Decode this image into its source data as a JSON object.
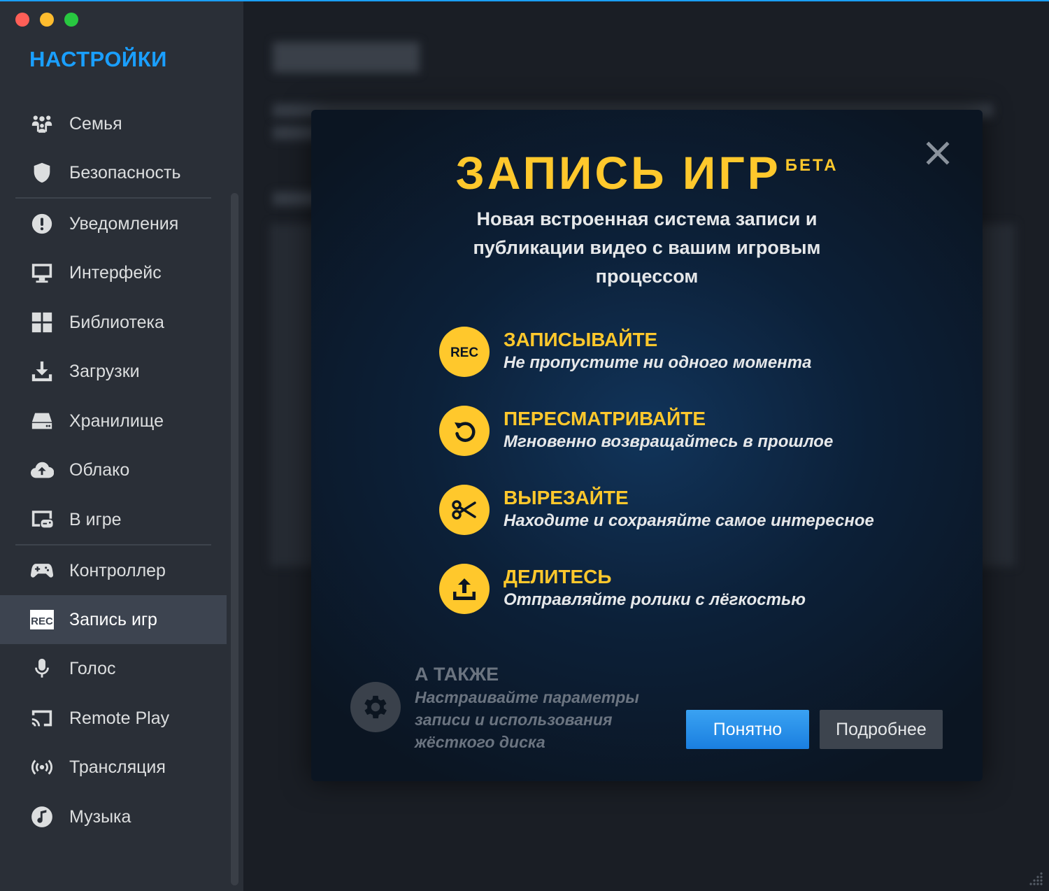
{
  "sidebar": {
    "title": "НАСТРОЙКИ",
    "items": [
      {
        "label": "Семья",
        "icon": "family-icon"
      },
      {
        "label": "Безопасность",
        "icon": "shield-icon"
      },
      {
        "label": "Уведомления",
        "icon": "notification-icon"
      },
      {
        "label": "Интерфейс",
        "icon": "monitor-icon"
      },
      {
        "label": "Библиотека",
        "icon": "grid-icon"
      },
      {
        "label": "Загрузки",
        "icon": "download-icon"
      },
      {
        "label": "Хранилище",
        "icon": "drive-icon"
      },
      {
        "label": "Облако",
        "icon": "cloud-icon"
      },
      {
        "label": "В игре",
        "icon": "ingame-icon"
      },
      {
        "label": "Контроллер",
        "icon": "gamepad-icon"
      },
      {
        "label": "Запись игр",
        "icon": "rec-icon",
        "active": true
      },
      {
        "label": "Голос",
        "icon": "microphone-icon"
      },
      {
        "label": "Remote Play",
        "icon": "cast-icon"
      },
      {
        "label": "Трансляция",
        "icon": "broadcast-icon"
      },
      {
        "label": "Музыка",
        "icon": "music-icon"
      }
    ]
  },
  "modal": {
    "title": "ЗАПИСЬ ИГР",
    "badge": "БЕТА",
    "subtitle": "Новая встроенная система записи и публикации видео с вашим игровым процессом",
    "features": [
      {
        "heading": "ЗАПИСЫВАЙТЕ",
        "description": "Не пропустите ни одного момента",
        "icon": "rec-icon"
      },
      {
        "heading": "ПЕРЕСМАТРИВАЙТЕ",
        "description": "Мгновенно возвращайтесь в прошлое",
        "icon": "replay-icon"
      },
      {
        "heading": "ВЫРЕЗАЙТЕ",
        "description": "Находите и сохраняйте самое интересное",
        "icon": "scissors-icon"
      },
      {
        "heading": "ДЕЛИТЕСЬ",
        "description": "Отправляйте ролики с лёгкостью",
        "icon": "upload-icon"
      }
    ],
    "also": {
      "heading": "А ТАКЖЕ",
      "description": "Настраивайте параметры записи и использования жёсткого диска",
      "icon": "gear-icon"
    },
    "buttons": {
      "ok": "Понятно",
      "more": "Подробнее"
    }
  },
  "colors": {
    "accent": "#1a9fff",
    "highlight": "#ffc82c",
    "sidebar_bg": "#2a2f37"
  }
}
